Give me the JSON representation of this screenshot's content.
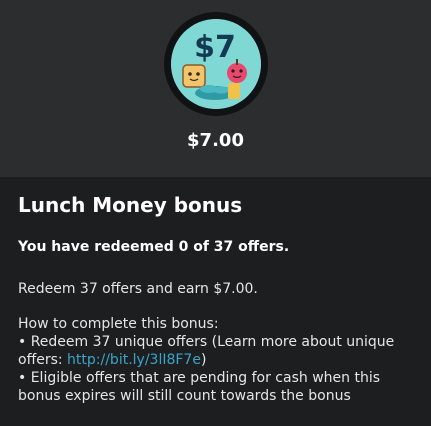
{
  "reward": {
    "badge_amount": "$7",
    "amount": "$7.00"
  },
  "bonus": {
    "title": "Lunch Money bonus",
    "progress_text": "You have redeemed 0 of 37 offers.",
    "earn_text": "Redeem 37 offers and earn $7.00.",
    "howto_heading": "How to complete this bonus:",
    "bullet1_prefix": "• Redeem 37 unique offers (Learn more about unique offers: ",
    "bullet1_link": "http://bit.ly/3lI8F7e",
    "bullet1_suffix": ")",
    "bullet2": "• Eligible offers that are pending for cash when this bonus expires will still count towards the bonus"
  },
  "colors": {
    "page_bg": "#1d1e20",
    "header_bg": "#2c2d2f",
    "badge_bg": "#7fd8d4",
    "link": "#3aa4c9"
  },
  "icons": {
    "badge": "lunch-money-badge-icon"
  }
}
